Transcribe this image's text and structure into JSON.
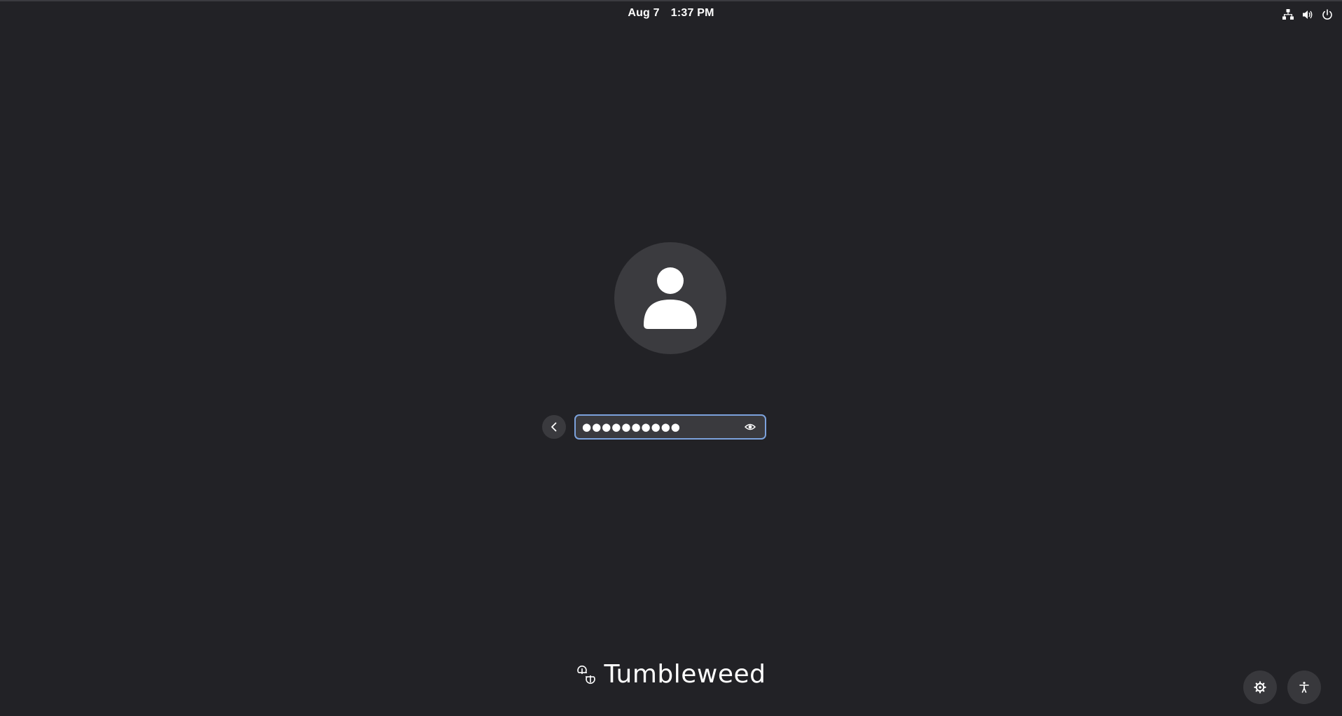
{
  "topbar": {
    "date": "Aug 7",
    "time": "1:37 PM",
    "icons": [
      "network-wired-icon",
      "volume-icon",
      "power-icon"
    ]
  },
  "user": {
    "avatar_icon": "user-avatar-icon"
  },
  "login": {
    "back_icon": "chevron-left-icon",
    "password_value": "●●●●●●●●●●",
    "reveal_icon": "eye-icon"
  },
  "branding": {
    "logo_icon": "tumbleweed-logo",
    "name": "Tumbleweed"
  },
  "bottom_buttons": {
    "settings_icon": "gear-icon",
    "accessibility_icon": "accessibility-icon"
  },
  "colors": {
    "background": "#222226",
    "field_focus_border": "#7ca2dc",
    "button_bg": "#3a3a3e"
  }
}
